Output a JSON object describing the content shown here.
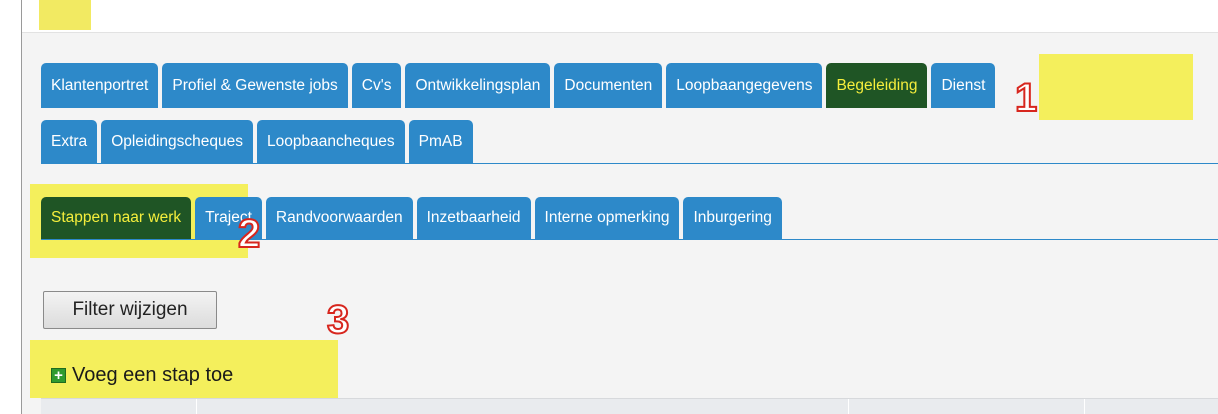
{
  "main_tabs_row1": [
    {
      "label": "Klantenportret"
    },
    {
      "label": "Profiel & Gewenste jobs"
    },
    {
      "label": "Cv's"
    },
    {
      "label": "Ontwikkelingsplan"
    },
    {
      "label": "Documenten"
    },
    {
      "label": "Loopbaangegevens"
    },
    {
      "label": "Begeleiding"
    },
    {
      "label": "Dienst"
    }
  ],
  "main_tabs_row2": [
    {
      "label": "Extra"
    },
    {
      "label": "Opleidingscheques"
    },
    {
      "label": "Loopbaancheques"
    },
    {
      "label": "PmAB"
    }
  ],
  "sub_tabs": [
    {
      "label": "Stappen naar werk"
    },
    {
      "label": "Traject"
    },
    {
      "label": "Randvoorwaarden"
    },
    {
      "label": "Inzetbaarheid"
    },
    {
      "label": "Interne opmerking"
    },
    {
      "label": "Inburgering"
    }
  ],
  "filter_button": {
    "label": "Filter wijzigen"
  },
  "add_step": {
    "label": "Voeg een stap toe",
    "icon": "plus-icon"
  },
  "annotations": {
    "one": "1",
    "two": "2",
    "three": "3"
  },
  "colors": {
    "tab_blue": "#2d89c9",
    "active_tab": "#1f5525",
    "active_text": "#f5ee3c",
    "highlight": "#f4ef5c",
    "annotation_red": "#d7261e"
  }
}
